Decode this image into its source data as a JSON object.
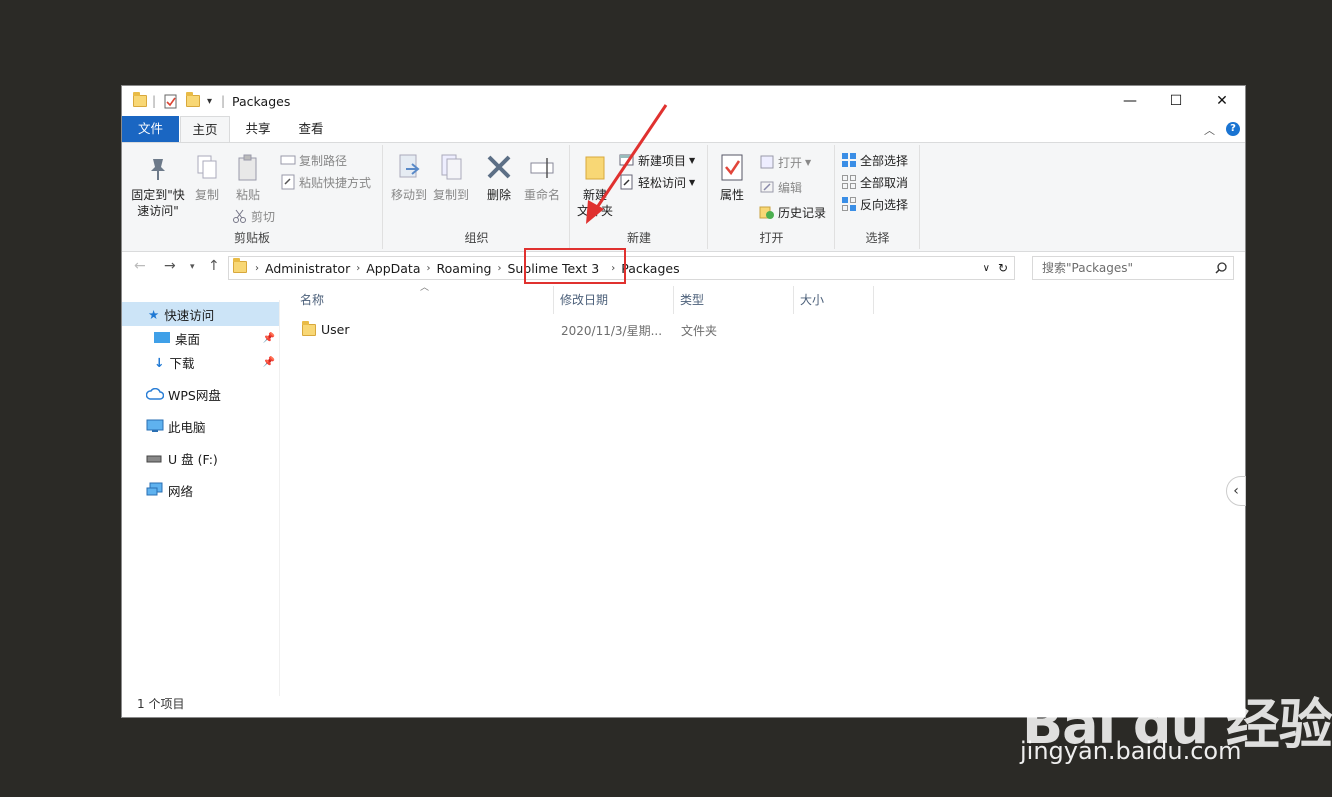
{
  "window": {
    "title": "Packages",
    "minimize": "—",
    "maximize": "☐",
    "close": "✕"
  },
  "tabs": [
    "文件",
    "主页",
    "共享",
    "查看"
  ],
  "ribbon": {
    "clipboard": {
      "label": "剪贴板",
      "pin_line1": "固定到\"快",
      "pin_line2": "速访问\"",
      "copy": "复制",
      "paste": "粘贴",
      "copy_path": "复制路径",
      "paste_shortcut": "粘贴快捷方式",
      "cut": "剪切"
    },
    "organize": {
      "label": "组织",
      "move_to": "移动到",
      "copy_to": "复制到",
      "delete": "删除",
      "rename": "重命名"
    },
    "new": {
      "label": "新建",
      "new_folder_line1": "新建",
      "new_folder_line2": "文件夹",
      "new_item": "新建项目",
      "easy_access": "轻松访问"
    },
    "open": {
      "label": "打开",
      "properties": "属性",
      "open": "打开",
      "edit": "编辑",
      "history": "历史记录"
    },
    "select": {
      "label": "选择",
      "select_all": "全部选择",
      "select_none": "全部取消",
      "invert": "反向选择"
    }
  },
  "address": {
    "crumbs": [
      "Administrator",
      "AppData",
      "Roaming",
      "Sublime Text 3",
      "Packages"
    ],
    "search_placeholder": "搜索\"Packages\""
  },
  "nav": {
    "quick_access": "快速访问",
    "desktop": "桌面",
    "downloads": "下载",
    "wps": "WPS网盘",
    "this_pc": "此电脑",
    "udisk": "U 盘 (F:)",
    "network": "网络"
  },
  "columns": [
    "名称",
    "修改日期",
    "类型",
    "大小"
  ],
  "files": [
    {
      "name": "User",
      "modified": "2020/11/3/星期...",
      "type": "文件夹",
      "size": ""
    }
  ],
  "status": "1 个项目",
  "watermark": {
    "logo": "Bai du 经验",
    "url": "jingyan.baidu.com"
  },
  "colors": {
    "accent": "#1a66c2",
    "highlight_box": "#e0312f",
    "selection": "#cce4f7"
  }
}
